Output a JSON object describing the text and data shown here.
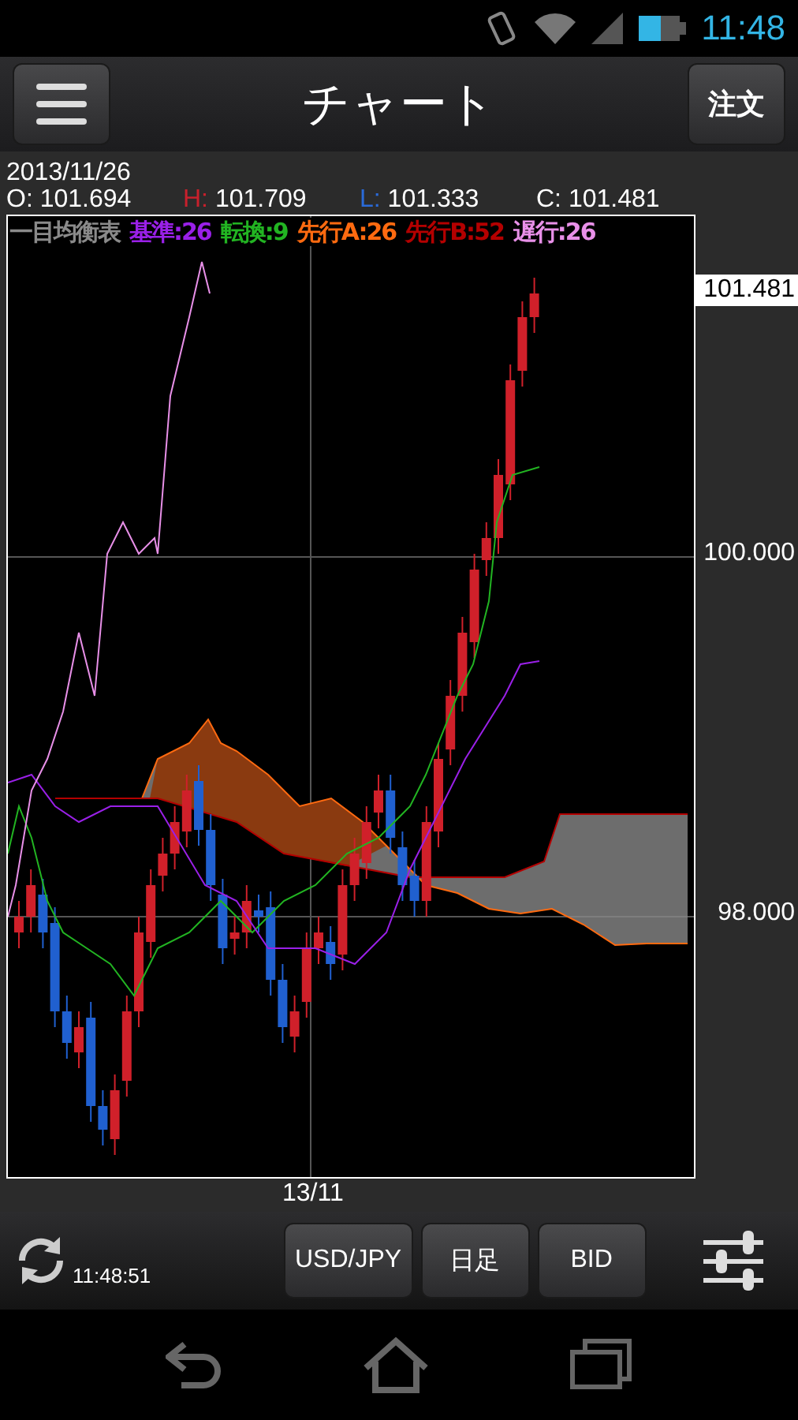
{
  "status_bar": {
    "time": "11:48"
  },
  "header": {
    "title": "チャート",
    "order_button": "注文"
  },
  "quote": {
    "date": "2013/11/26",
    "fields": [
      {
        "label": "O:",
        "value": "101.694",
        "color": "#ffffff"
      },
      {
        "label": "H:",
        "value": "101.709",
        "color": "#c8202c"
      },
      {
        "label": "L:",
        "value": "101.333",
        "color": "#2a6ad8"
      },
      {
        "label": "C:",
        "value": "101.481",
        "color": "#ffffff"
      }
    ]
  },
  "chart": {
    "legend": [
      {
        "text": "一目均衡表",
        "color": "#8a8a8a"
      },
      {
        "text": "基準:26",
        "color": "#9a20e8"
      },
      {
        "text": "転換:9",
        "color": "#22b422"
      },
      {
        "text": "先行A:26",
        "color": "#ff6a10"
      },
      {
        "text": "先行B:52",
        "color": "#b40000"
      },
      {
        "text": "遅行:26",
        "color": "#e890e8"
      }
    ],
    "price_labels": [
      {
        "text": "101.481",
        "kind": "current"
      },
      {
        "text": "100.000",
        "kind": "grid"
      },
      {
        "text": "98.000",
        "kind": "grid"
      }
    ],
    "x_label": "13/11"
  },
  "toolbar": {
    "update_time": "11:48:51",
    "buttons": [
      "USD/JPY",
      "日足",
      "BID"
    ]
  }
}
